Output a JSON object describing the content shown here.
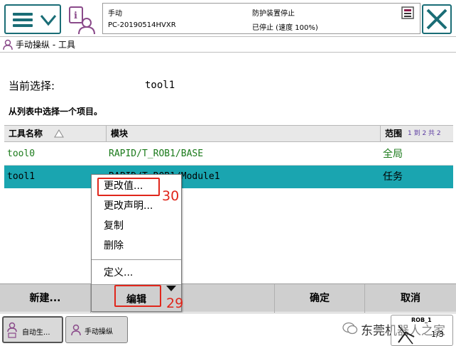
{
  "status": {
    "mode": "手动",
    "controller": "PC-20190514HVXR",
    "safety": "防护装置停止",
    "state": "已停止 (速度 100%)"
  },
  "title": "手动操纵 - 工具",
  "current_selection": {
    "label": "当前选择:",
    "value": "tool1"
  },
  "instruction": "从列表中选择一个项目。",
  "table": {
    "columns": [
      "工具名称",
      "模块",
      "范围"
    ],
    "pagination": "1 到 2 共 2",
    "rows": [
      {
        "name": "tool0",
        "module": "RAPID/T_ROB1/BASE",
        "scope": "全局"
      },
      {
        "name": "tool1",
        "module": "RAPID/T_ROB1/Module1",
        "scope": "任务"
      }
    ]
  },
  "popup_menu": {
    "items": [
      "更改值...",
      "更改声明...",
      "复制",
      "删除",
      "定义..."
    ]
  },
  "command_bar": {
    "new": "新建...",
    "edit": "编辑",
    "ok": "确定",
    "cancel": "取消"
  },
  "annotations": {
    "edit_step": "29",
    "change_value_step": "30"
  },
  "taskbar": {
    "auto_task": "自动生...",
    "jog_task": "手动操纵",
    "rob_label": "ROB_1",
    "fraction": "1/3"
  },
  "watermark": "东莞机器人之家",
  "colors": {
    "accent": "#1a6d76",
    "selected_row": "#1aa5b0",
    "green_text": "#1a7a1a",
    "annotation": "#e0261b"
  }
}
